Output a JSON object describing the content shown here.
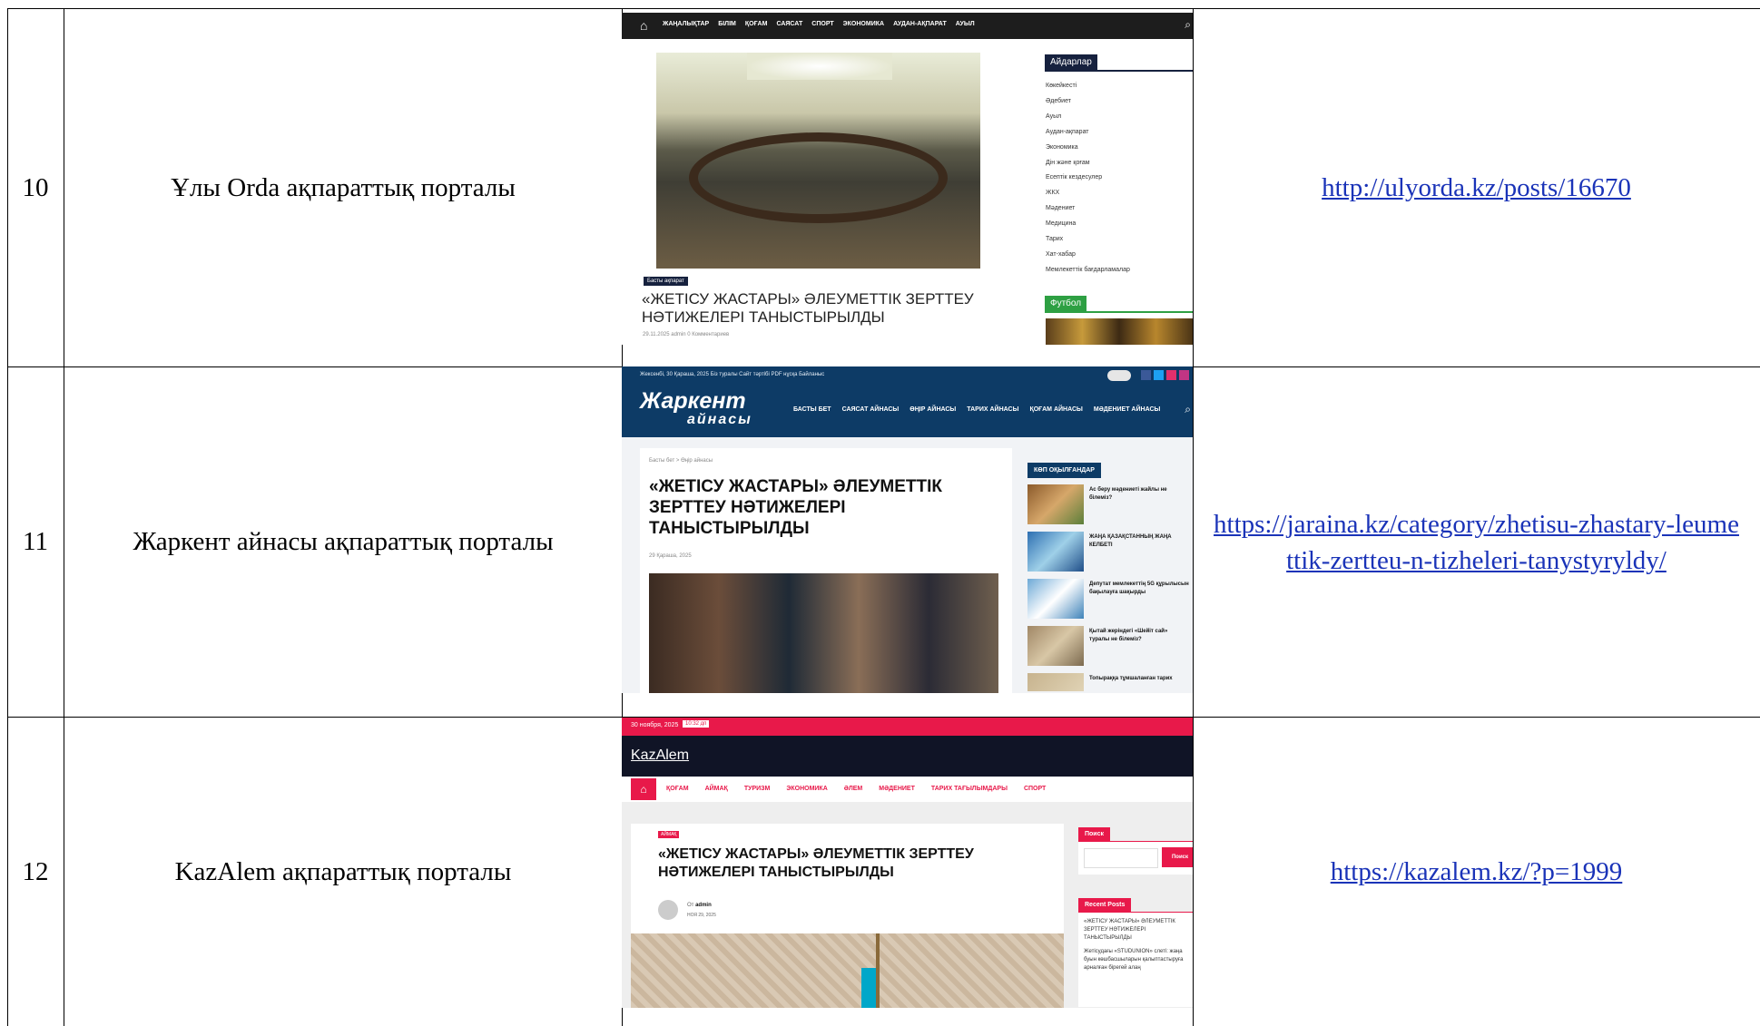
{
  "rows": [
    {
      "num": "10",
      "name": "Ұлы Orda ақпараттық порталы",
      "url": "http://ulyorda.kz/posts/16670",
      "screenshot": {
        "nav": [
          "ЖАҢАЛЫҚТАР",
          "БІЛІМ",
          "ҚОҒАМ",
          "САЯСАТ",
          "СПОРТ",
          "ЭКОНОМИКА",
          "АУДАН-АҚПАРАТ",
          "АУЫЛ"
        ],
        "sidebar_title": "Айдарлар",
        "sidebar_items": [
          "Көкейкесті",
          "Әдебиет",
          "Ауыл",
          "Аудан-ақпарат",
          "Экономика",
          "Дін және қоғам",
          "Есептік кездесулер",
          "ЖКХ",
          "Мәдениет",
          "Медицина",
          "Тарих",
          "Хат-хабар",
          "Мемлекеттік бағдарламалар"
        ],
        "sidebar_title2": "Футбол",
        "badge": "Басты ақпарат",
        "headline": "«ЖЕТІСУ ЖАСТАРЫ» ӘЛЕУМЕТТІК ЗЕРТТЕУ НӘТИЖЕЛЕРІ ТАНЫСТЫРЫЛДЫ",
        "meta": "29.11.2025  admin  0 Комментариев"
      }
    },
    {
      "num": "11",
      "name": "Жаркент айнасы ақпараттық порталы",
      "url": "https://jaraina.kz/category/zhetisu-zhastary-leumettik-zertteu-n-tizheleri-tanystyryldy/",
      "screenshot": {
        "topbar": "Жексенбі, 30 Қараша, 2025   Біз туралы  Сайт тәртібі  PDF нұсқа  Байланыс",
        "logo_top": "Жаркент",
        "logo_bottom": "айнасы",
        "nav": [
          "БАСТЫ БЕТ",
          "САЯСАТ АЙНАСЫ",
          "ӨҢІР АЙНАСЫ",
          "ТАРИХ АЙНАСЫ",
          "ҚОҒАМ АЙНАСЫ",
          "МӘДЕНИЕТ АЙНАСЫ"
        ],
        "breadcrumb": "Басты бет > Өңір айнасы",
        "headline": "«ЖЕТІСУ ЖАСТАРЫ» ӘЛЕУМЕТТІК ЗЕРТТЕУ НӘТИЖЕЛЕРІ ТАНЫСТЫРЫЛДЫ",
        "date": "29 Қараша, 2025",
        "sidebar_title": "КӨП ОҚЫЛҒАНДАР",
        "sidebar_items": [
          "Ас беру мәдениеті жайлы не білеміз?",
          "ЖАҢА ҚАЗАҚСТАННЫҢ ЖАҢА КЕЛБЕТІ",
          "Депутат мемлекеттің 5G құрылысын бақылауға шақырды",
          "Қытай жеріндегі «Шейіт сай» туралы не білеміз?",
          "Топыраққа тұмшаланған тарих"
        ]
      }
    },
    {
      "num": "12",
      "name": "KazAlem ақпараттық порталы",
      "url": "https://kazalem.kz/?p=1999",
      "screenshot": {
        "topbar_date": "30 ноября, 2025",
        "topbar_time": "10:32 дп",
        "logo": "KazAlem",
        "nav": [
          "ҚОҒАМ",
          "АЙМАҚ",
          "ТУРИЗМ",
          "ЭКОНОМИКА",
          "ӘЛЕМ",
          "МӘДЕНИЕТ",
          "ТАРИХ ТАҒЫЛЫМДАРЫ",
          "СПОРТ"
        ],
        "category": "АЙМАҚ",
        "headline": "«ЖЕТІСУ ЖАСТАРЫ» ӘЛЕУМЕТТІК ЗЕРТТЕУ НӘТИЖЕЛЕРІ ТАНЫСТЫРЫЛДЫ",
        "author_prefix": "От",
        "author": "admin",
        "date": "НОЯ 29, 2025",
        "search_title": "Поиск",
        "search_button": "Поиск",
        "recent_title": "Recent Posts",
        "recent_items": [
          "«ЖЕТІСУ ЖАСТАРЫ» ӘЛЕУМЕТТІК ЗЕРТТЕУ НӘТИЖЕЛЕРІ ТАНЫСТЫРЫЛДЫ",
          "Жетісудағы «STUDUNION» слеті: жаңа буын көшбасшыларын қалыптастыруға арналған бірегей алаң"
        ]
      }
    }
  ]
}
